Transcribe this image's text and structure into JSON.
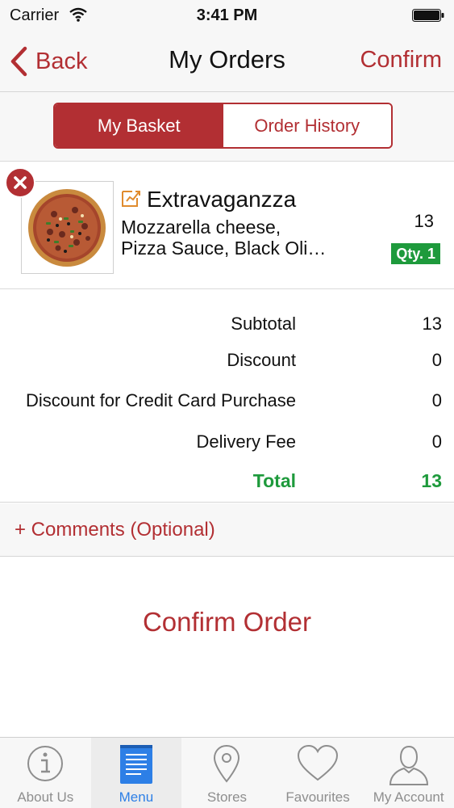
{
  "status_bar": {
    "carrier": "Carrier",
    "time": "3:41 PM",
    "wifi_icon": "wifi-icon",
    "battery_icon": "battery-icon"
  },
  "nav": {
    "back_label": "Back",
    "title": "My Orders",
    "confirm_label": "Confirm",
    "accent_color": "#b22f33"
  },
  "segments": [
    {
      "label": "My Basket",
      "active": true
    },
    {
      "label": "Order History",
      "active": false
    }
  ],
  "basket": {
    "items": [
      {
        "name": "Extravaganzza",
        "description_line1": "Mozzarella cheese,",
        "description_line2": "Pizza Sauce, Black Oli…",
        "price": "13",
        "qty": "Qty. 1",
        "image_icon": "pizza-image",
        "remove_icon": "close-icon",
        "edit_icon": "edit-icon"
      }
    ]
  },
  "totals": {
    "subtotal_label": "Subtotal",
    "subtotal_value": "13",
    "discount_label": "Discount",
    "discount_value": "0",
    "cc_discount_label": "Discount for Credit Card Purchase",
    "cc_discount_value": "0",
    "delivery_label": "Delivery Fee",
    "delivery_value": "0",
    "total_label": "Total",
    "total_value": "13",
    "total_color": "#1e9a3c"
  },
  "comments_label": "+ Comments (Optional)",
  "confirm_order_label": "Confirm Order",
  "tabs": [
    {
      "label": "About Us",
      "icon": "info-icon",
      "active": false
    },
    {
      "label": "Menu",
      "icon": "menu-book-icon",
      "active": true
    },
    {
      "label": "Stores",
      "icon": "map-pin-icon",
      "active": false
    },
    {
      "label": "Favourites",
      "icon": "heart-icon",
      "active": false
    },
    {
      "label": "My Account",
      "icon": "person-icon",
      "active": false
    }
  ]
}
